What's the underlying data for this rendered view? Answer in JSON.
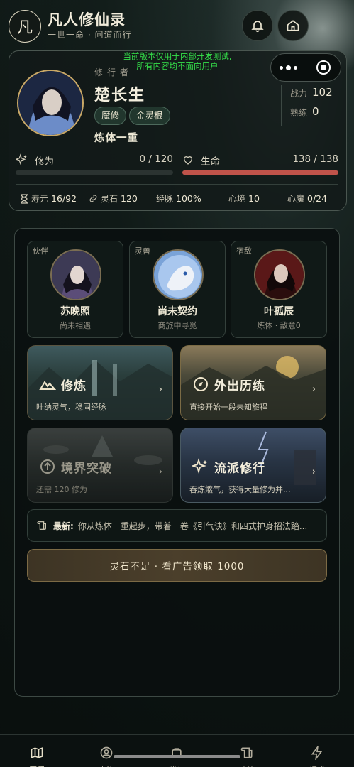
{
  "header": {
    "logo_char": "凡",
    "title": "凡人修仙录",
    "subtitle": "一世一命 · 问道而行",
    "bell_icon": "bell-icon",
    "home_icon": "home-icon"
  },
  "dev_notice": {
    "line1": "当前版本仅用于内部开发测试,",
    "line2": "所有内容均不面向用户"
  },
  "profile": {
    "label": "修行者",
    "name": "楚长生",
    "tags": [
      "魔修",
      "金灵根"
    ],
    "realm": "炼体一重",
    "combat_power_label": "战力",
    "combat_power": "102",
    "proficiency_label": "熟练",
    "proficiency": "0",
    "cultivation_label": "修为",
    "cultivation_text": "0 / 120",
    "cultivation_fraction": 0,
    "life_label": "生命",
    "life_text": "138 / 138",
    "life_fraction": 1.0,
    "resources": [
      {
        "label": "寿元",
        "value": "16/92"
      },
      {
        "label": "灵石",
        "value": "120"
      },
      {
        "label": "经脉",
        "value": "100%"
      },
      {
        "label": "心境",
        "value": "10"
      },
      {
        "label": "心魔",
        "value": "0/24"
      }
    ]
  },
  "companions": [
    {
      "tag": "伙伴",
      "name": "苏晚照",
      "sub": "尚未相遇"
    },
    {
      "tag": "灵兽",
      "name": "尚未契约",
      "sub": "商旅中寻觅"
    },
    {
      "tag": "宿敌",
      "name": "叶孤辰",
      "sub": "炼体 · 敌意0"
    }
  ],
  "actions": [
    {
      "title": "修炼",
      "sub": "吐纳灵气，稳固经脉"
    },
    {
      "title": "外出历练",
      "sub": "直接开始一段未知旅程"
    },
    {
      "title": "境界突破",
      "sub": "还需 120 修为"
    },
    {
      "title": "流派修行",
      "sub": "吞炼煞气，获得大量修为并..."
    }
  ],
  "news": {
    "label": "最新:",
    "text": "你从炼体一重起步，带着一卷《引气诀》和四式护身招法踏..."
  },
  "ad_button": "灵石不足 · 看广告领取 1000",
  "nav": [
    {
      "label": "历程"
    },
    {
      "label": "人物"
    },
    {
      "label": "背包"
    },
    {
      "label": "功法"
    },
    {
      "label": "招式"
    }
  ],
  "colors": {
    "accent_gold": "#c9a866",
    "life_bar": "#c0534a",
    "dev_text": "#35e04a"
  }
}
